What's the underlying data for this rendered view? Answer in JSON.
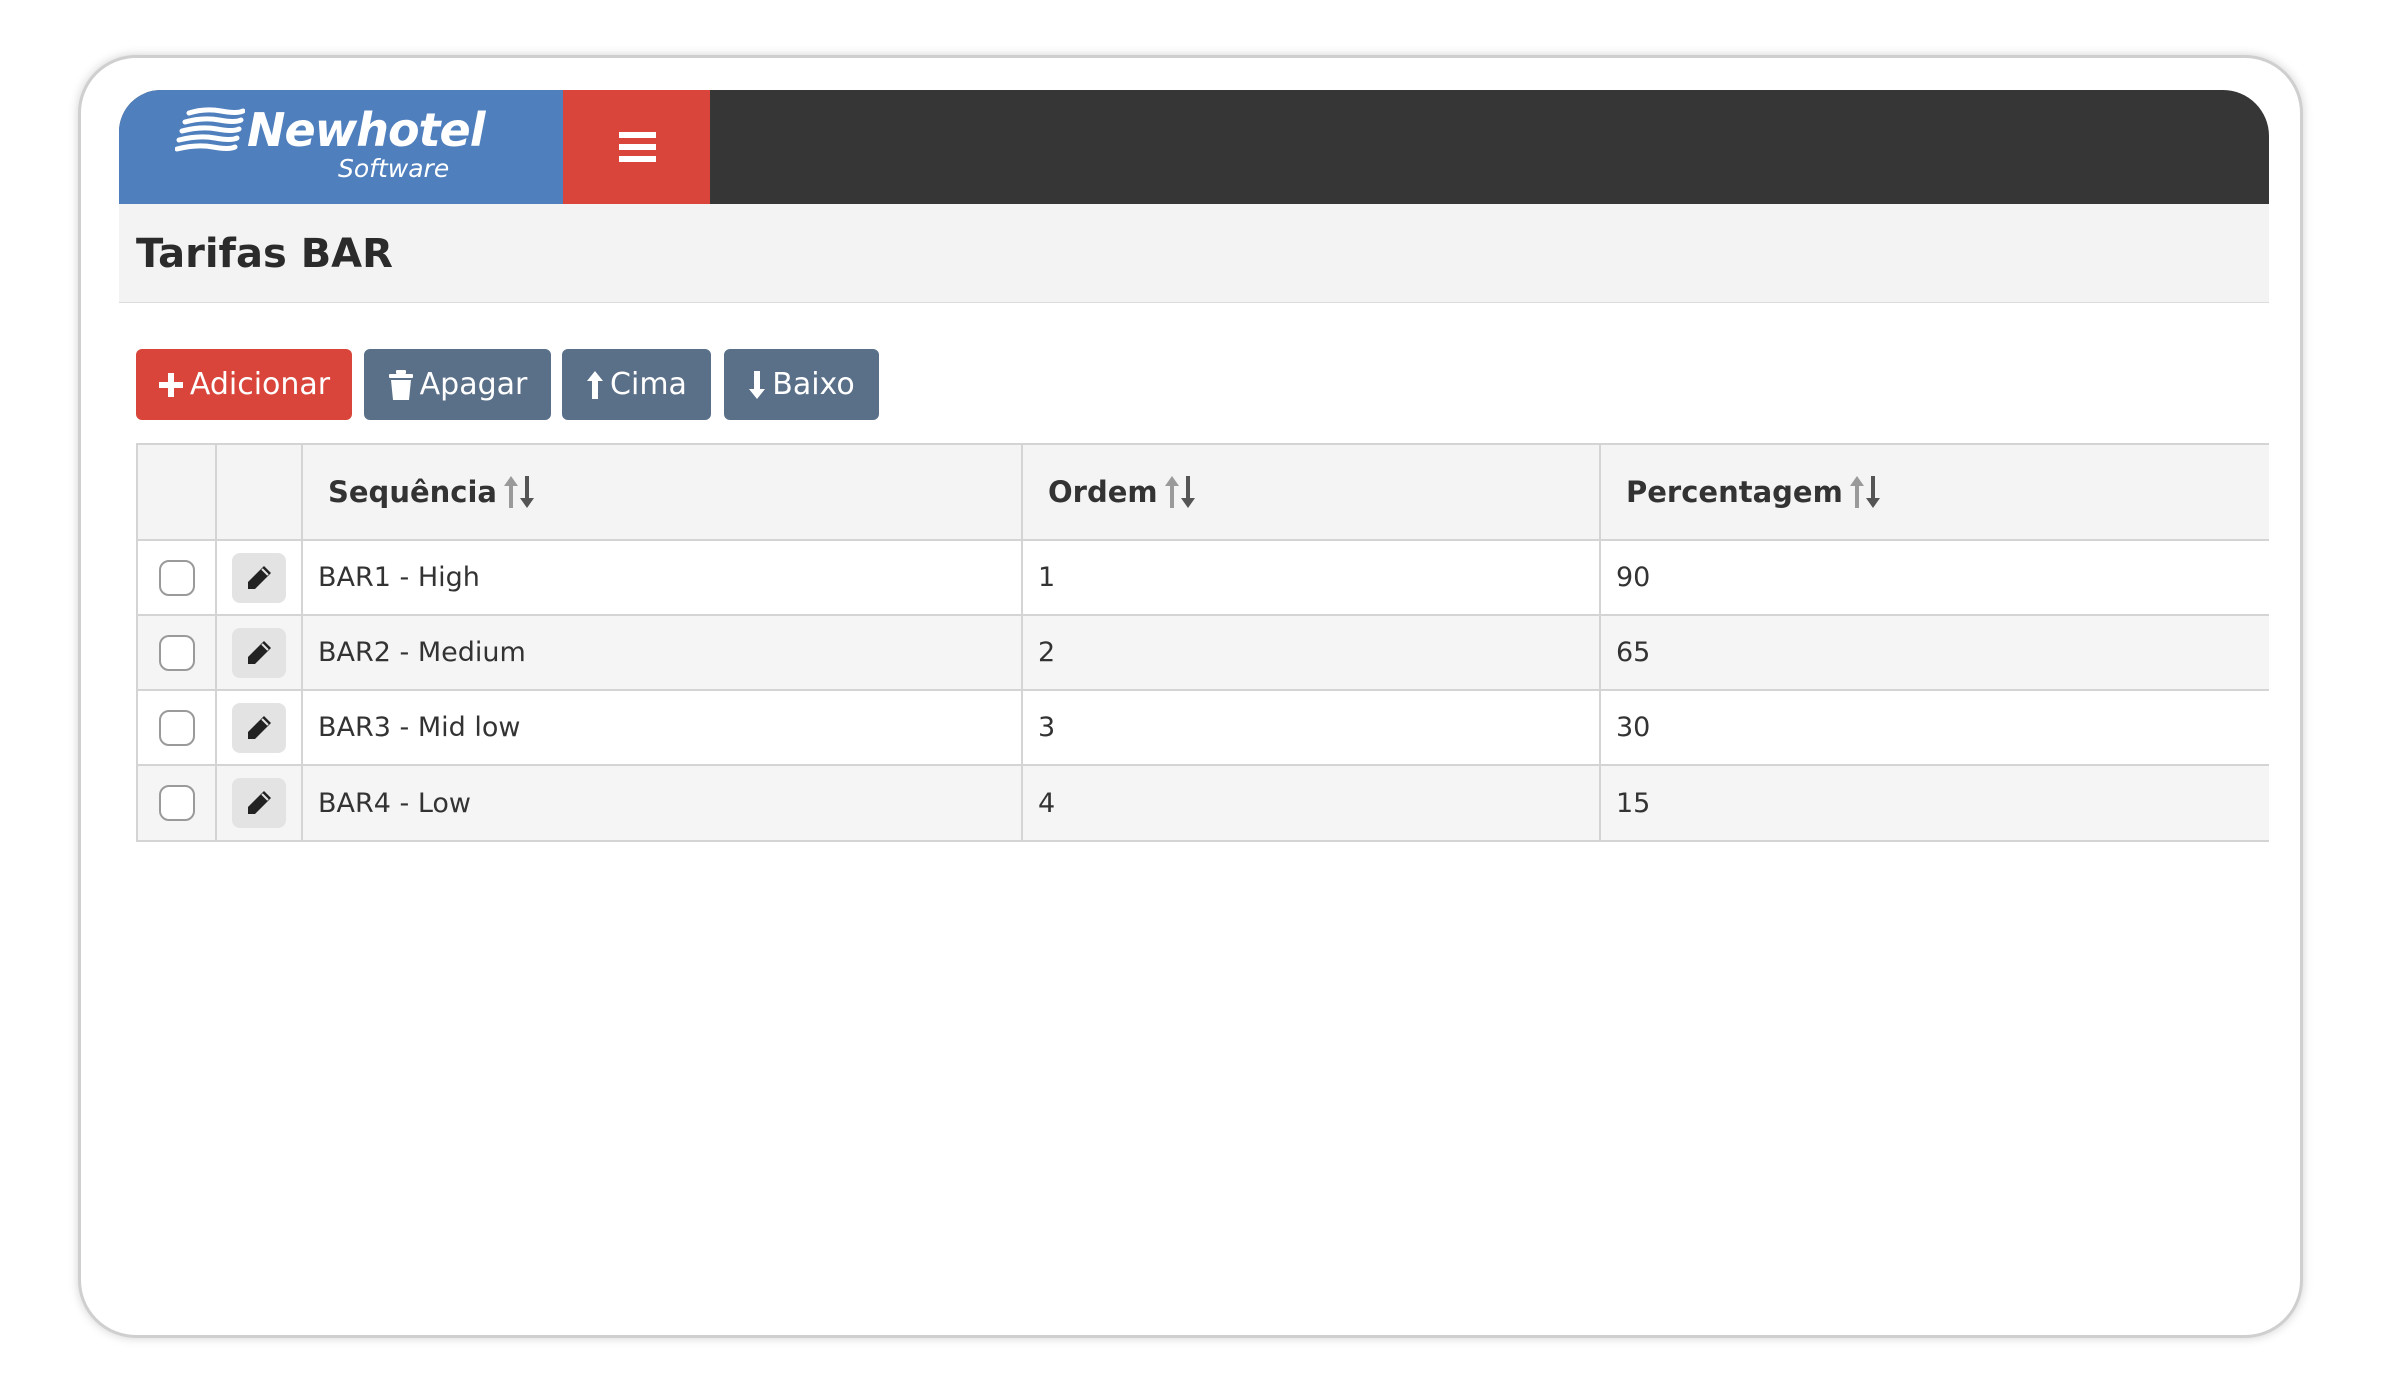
{
  "app": {
    "brand_name": "Newhotel",
    "brand_sub": "Software"
  },
  "page": {
    "title": "Tarifas BAR"
  },
  "toolbar": {
    "add_label": "Adicionar",
    "delete_label": "Apagar",
    "up_label": "Cima",
    "down_label": "Baixo"
  },
  "table": {
    "columns": [
      "Sequência",
      "Ordem",
      "Percentagem"
    ],
    "rows": [
      {
        "sequencia": "BAR1 - High",
        "ordem": "1",
        "percentagem": "90",
        "checked": false
      },
      {
        "sequencia": "BAR2 - Medium",
        "ordem": "2",
        "percentagem": "65",
        "checked": false
      },
      {
        "sequencia": "BAR3 - Mid low",
        "ordem": "3",
        "percentagem": "30",
        "checked": false
      },
      {
        "sequencia": "BAR4 - Low",
        "ordem": "4",
        "percentagem": "15",
        "checked": false
      }
    ]
  },
  "icons": {
    "menu": "hamburger-icon",
    "add": "plus-icon",
    "delete": "trash-icon",
    "up": "arrow-up-icon",
    "down": "arrow-down-icon",
    "sort": "sort-icon",
    "edit": "pencil-icon"
  },
  "colors": {
    "header_dark": "#363636",
    "logo_blue": "#4f7fbd",
    "accent_red": "#d9453a",
    "button_slate": "#5a6f88"
  }
}
